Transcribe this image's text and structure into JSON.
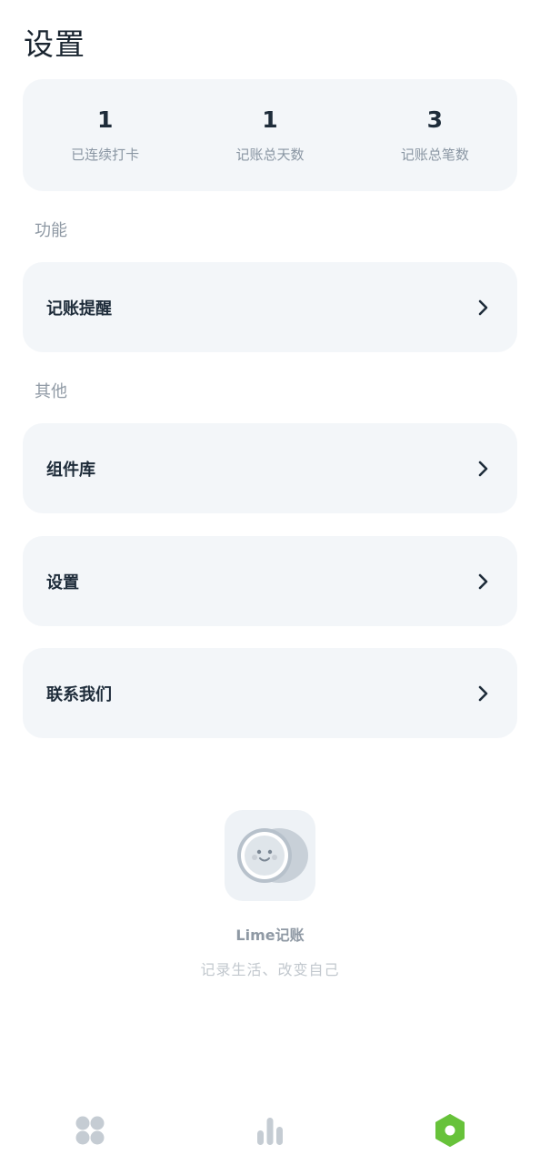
{
  "header": {
    "title": "设置"
  },
  "stats": [
    {
      "value": "1",
      "label": "已连续打卡"
    },
    {
      "value": "1",
      "label": "记账总天数"
    },
    {
      "value": "3",
      "label": "记账总笔数"
    }
  ],
  "sections": {
    "features": {
      "label": "功能",
      "items": [
        {
          "label": "记账提醒"
        }
      ]
    },
    "other": {
      "label": "其他",
      "items": [
        {
          "label": "组件库"
        },
        {
          "label": "设置"
        },
        {
          "label": "联系我们"
        }
      ]
    }
  },
  "brand": {
    "name": "Lime记账",
    "slogan": "记录生活、改变自己"
  },
  "tabbar": {
    "items": [
      {
        "icon": "grid-icon",
        "active": false
      },
      {
        "icon": "chart-icon",
        "active": false
      },
      {
        "icon": "hexagon-icon",
        "active": true
      }
    ],
    "active_color": "#67c23a",
    "inactive_color": "#c5ccd3"
  }
}
